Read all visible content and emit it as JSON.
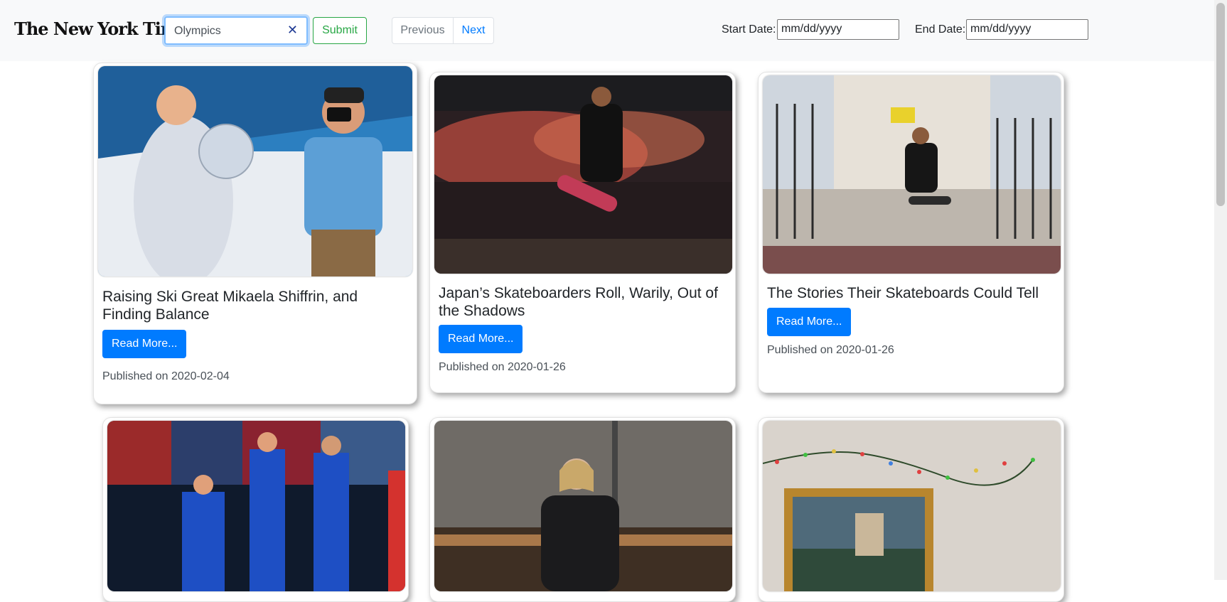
{
  "header": {
    "brand": "The New York Times",
    "search": {
      "value": "Olympics",
      "placeholder": ""
    },
    "submit_label": "Submit",
    "pagination": {
      "previous": "Previous",
      "next": "Next"
    },
    "start_date": {
      "label": "Start Date:",
      "placeholder": "mm/dd/yyyy"
    },
    "end_date": {
      "label": "End Date:",
      "placeholder": "mm/dd/yyyy"
    }
  },
  "icons": {
    "clear": "close-icon"
  },
  "colors": {
    "primary": "#007bff",
    "success": "#28a745",
    "navbar_bg": "#f8f9fa"
  },
  "articles": [
    {
      "title": "Raising Ski Great Mikaela Shiffrin, and Finding Balance",
      "read_more": "Read More...",
      "published": "Published on 2020-02-04"
    },
    {
      "title": "Japan’s Skateboarders Roll, Warily, Out of the Shadows",
      "read_more": "Read More...",
      "published": "Published on 2020-01-26"
    },
    {
      "title": "The Stories Their Skateboards Could Tell",
      "read_more": "Read More...",
      "published": "Published on 2020-01-26"
    },
    {
      "title": "",
      "read_more": "",
      "published": ""
    },
    {
      "title": "",
      "read_more": "",
      "published": ""
    },
    {
      "title": "",
      "read_more": "",
      "published": ""
    }
  ]
}
